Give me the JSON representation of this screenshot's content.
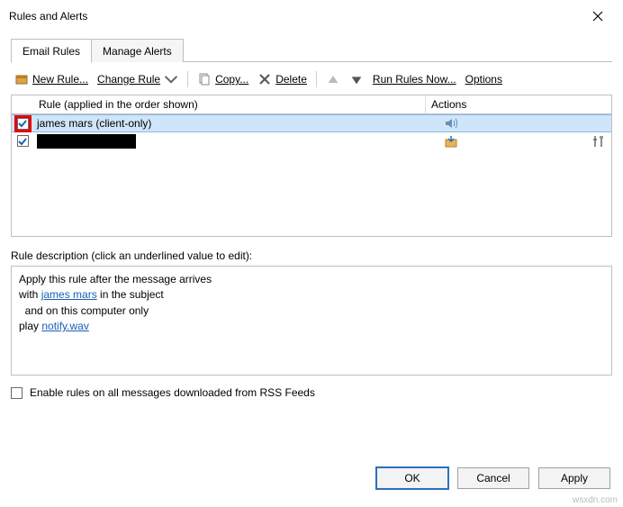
{
  "window": {
    "title": "Rules and Alerts"
  },
  "tabs": {
    "email_rules": "Email Rules",
    "manage_alerts": "Manage Alerts"
  },
  "toolbar": {
    "new_rule": "New Rule...",
    "change_rule": "Change Rule",
    "copy": "Copy...",
    "delete": "Delete",
    "run_rules": "Run Rules Now...",
    "options": "Options"
  },
  "rules_grid": {
    "header_rule": "Rule (applied in the order shown)",
    "header_actions": "Actions",
    "rows": [
      {
        "checked": true,
        "name": "james mars  (client-only)",
        "selected": true,
        "action_icon": "sound",
        "highlight_checkbox": true
      },
      {
        "checked": true,
        "name": "",
        "selected": false,
        "action_icon": "folder",
        "extra_icon": "tools"
      }
    ]
  },
  "description": {
    "label": "Rule description (click an underlined value to edit):",
    "line1": "Apply this rule after the message arrives",
    "line2a": "with ",
    "line2_link": "james mars",
    "line2b": " in the subject",
    "line3": "  and on this computer only",
    "line4a": "play ",
    "line4_link": "notify.wav"
  },
  "rss": {
    "label": "Enable rules on all messages downloaded from RSS Feeds",
    "checked": false
  },
  "buttons": {
    "ok": "OK",
    "cancel": "Cancel",
    "apply": "Apply"
  },
  "watermark": "wsxdn.com"
}
